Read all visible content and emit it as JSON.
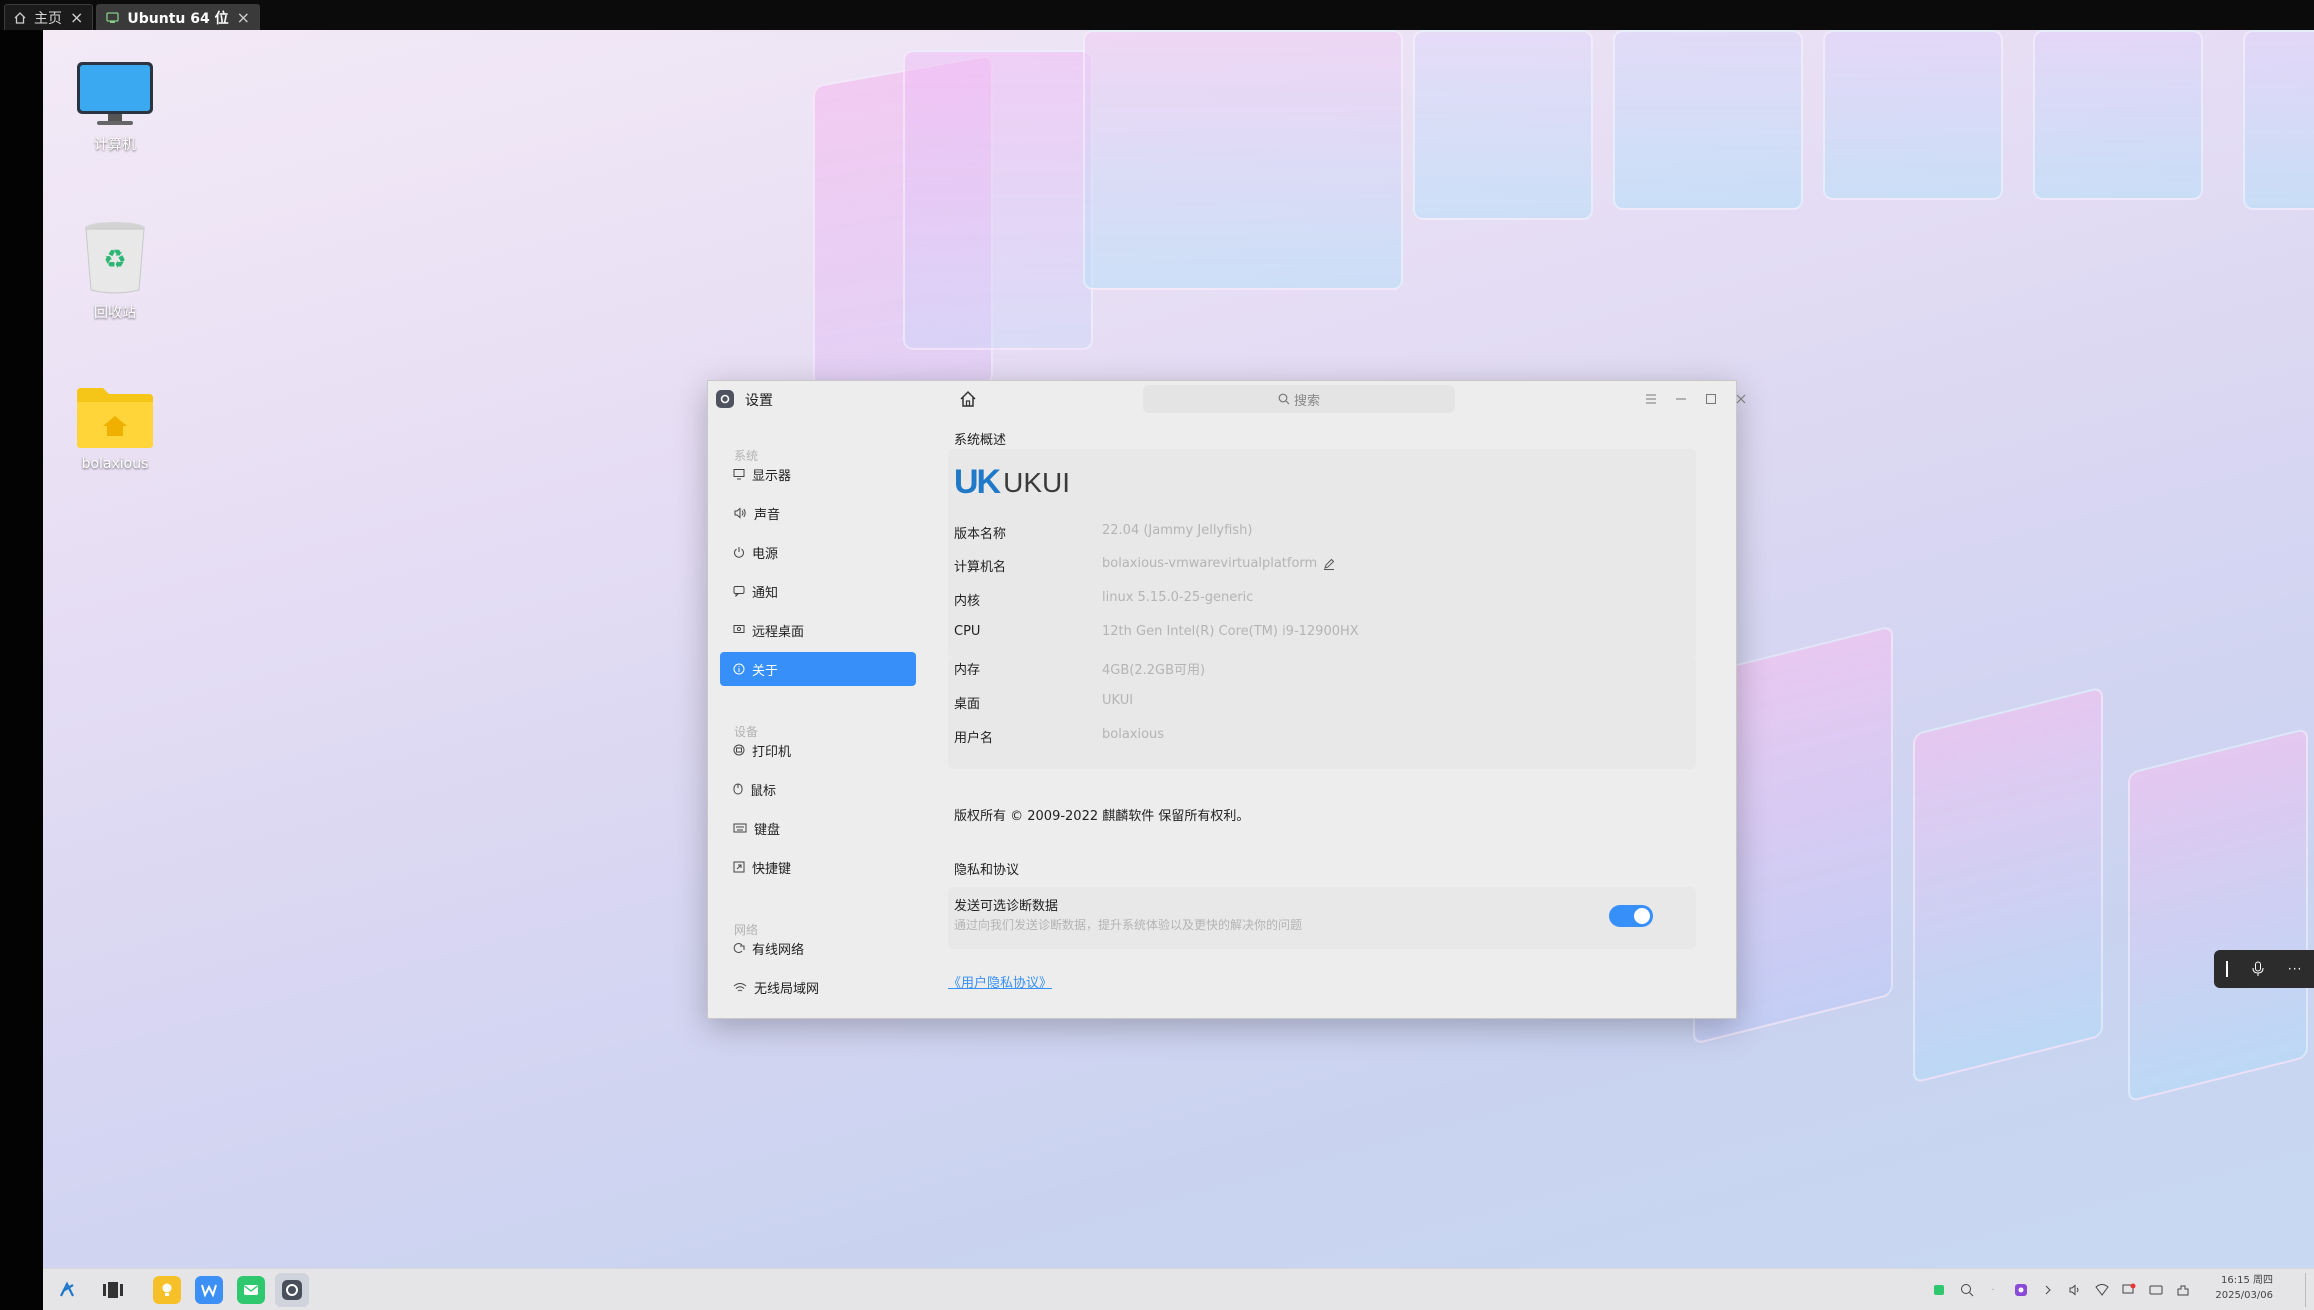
{
  "vm_tabs": [
    {
      "label": "主页"
    },
    {
      "label": "Ubuntu 64 位"
    }
  ],
  "desktop": {
    "icons": [
      {
        "label": "计算机"
      },
      {
        "label": "回收站"
      },
      {
        "label": "bolaxious"
      }
    ]
  },
  "window": {
    "title": "设置",
    "search_placeholder": "搜索",
    "sidebar": {
      "sections": [
        "系统",
        "设备",
        "网络"
      ],
      "items": [
        {
          "label": "显示器",
          "icon": "monitor-icon"
        },
        {
          "label": "声音",
          "icon": "speaker-icon"
        },
        {
          "label": "电源",
          "icon": "power-icon"
        },
        {
          "label": "通知",
          "icon": "notification-icon"
        },
        {
          "label": "远程桌面",
          "icon": "remote-desktop-icon"
        },
        {
          "label": "关于",
          "icon": "info-icon",
          "active": true
        },
        {
          "label": "打印机",
          "icon": "printer-icon"
        },
        {
          "label": "鼠标",
          "icon": "mouse-icon"
        },
        {
          "label": "键盘",
          "icon": "keyboard-icon"
        },
        {
          "label": "快捷键",
          "icon": "shortcut-icon"
        },
        {
          "label": "有线网络",
          "icon": "wired-network-icon"
        },
        {
          "label": "无线局域网",
          "icon": "wifi-icon"
        }
      ]
    },
    "content": {
      "overview_title": "系统概述",
      "logo_uk": "UK",
      "logo_ui": "UKUI",
      "info": [
        {
          "key": "版本名称",
          "value": "22.04 (Jammy Jellyfish)"
        },
        {
          "key": "计算机名",
          "value": "bolaxious-vmwarevirtualplatform"
        },
        {
          "key": "内核",
          "value": "linux 5.15.0-25-generic"
        },
        {
          "key": "CPU",
          "value": "12th Gen Intel(R) Core(TM) i9-12900HX"
        },
        {
          "key": "内存",
          "value": "4GB(2.2GB可用)"
        },
        {
          "key": "桌面",
          "value": "UKUI"
        },
        {
          "key": "用户名",
          "value": "bolaxious"
        }
      ],
      "copyright": "版权所有 © 2009-2022 麒麟软件 保留所有权利。",
      "privacy_title": "隐私和协议",
      "diag_title": "发送可选诊断数据",
      "diag_desc": "通过向我们发送诊断数据，提升系统体验以及更快的解决你的问题",
      "diag_enabled": true,
      "privacy_link": "《用户隐私协议》"
    }
  },
  "clock": {
    "time": "16:15 周四",
    "date": "2025/03/06"
  },
  "colors": {
    "accent": "#3790fa"
  }
}
